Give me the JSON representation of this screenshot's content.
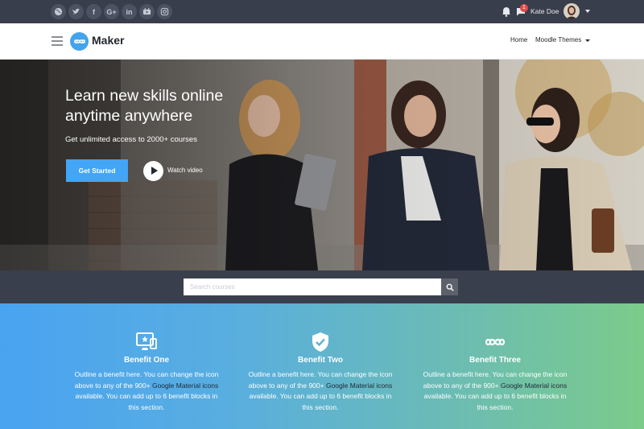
{
  "topbar": {
    "social_icons": [
      "globe-icon",
      "twitter-icon",
      "facebook-icon",
      "google-plus-icon",
      "linkedin-icon",
      "youtube-icon",
      "instagram-icon"
    ],
    "social_labels": {
      "facebook": "f",
      "google_plus": "G+",
      "linkedin": "in"
    },
    "notification_count": "1",
    "user_name": "Kate Doe"
  },
  "navbar": {
    "logo_text": "Maker",
    "links": [
      {
        "label": "Home"
      },
      {
        "label": "Moodle Themes"
      }
    ]
  },
  "hero": {
    "title": "Learn new skills online anytime anywhere",
    "subtitle": "Get unlimited access to 2000+ courses",
    "cta_label": "Get Started",
    "video_label": "Watch video"
  },
  "search": {
    "placeholder": "Search courses"
  },
  "benefits": [
    {
      "icon": "monitor-star-icon",
      "title": "Benefit One",
      "text_before": "Outline a benefit here. You can change the icon above to any of the 900+ ",
      "link_google": "Google",
      "link_material": "Material icons",
      "text_after": " available. You can add up to 6 benefit blocks in this section."
    },
    {
      "icon": "verified-shield-icon",
      "title": "Benefit Two",
      "text_before": "Outline a benefit here. You can change the icon above to any of the 900+ ",
      "link_google": "Google",
      "link_material": "Material icons",
      "text_after": " available. You can add up to 6 benefit blocks in this section."
    },
    {
      "icon": "infinity-icon",
      "title": "Benefit Three",
      "text_before": "Outline a benefit here. You can change the icon above to any of the 900+ ",
      "link_google": "Google",
      "link_material": "Material icons",
      "text_after": " available. You can add up to 6 benefit blocks in this section."
    }
  ],
  "colors": {
    "topbar": "#383e4b",
    "accent": "#42a5f5",
    "search_band": "#3a3f4d",
    "benefit_gradient_start": "#4aa3f1",
    "benefit_gradient_end": "#7ccb8b"
  }
}
